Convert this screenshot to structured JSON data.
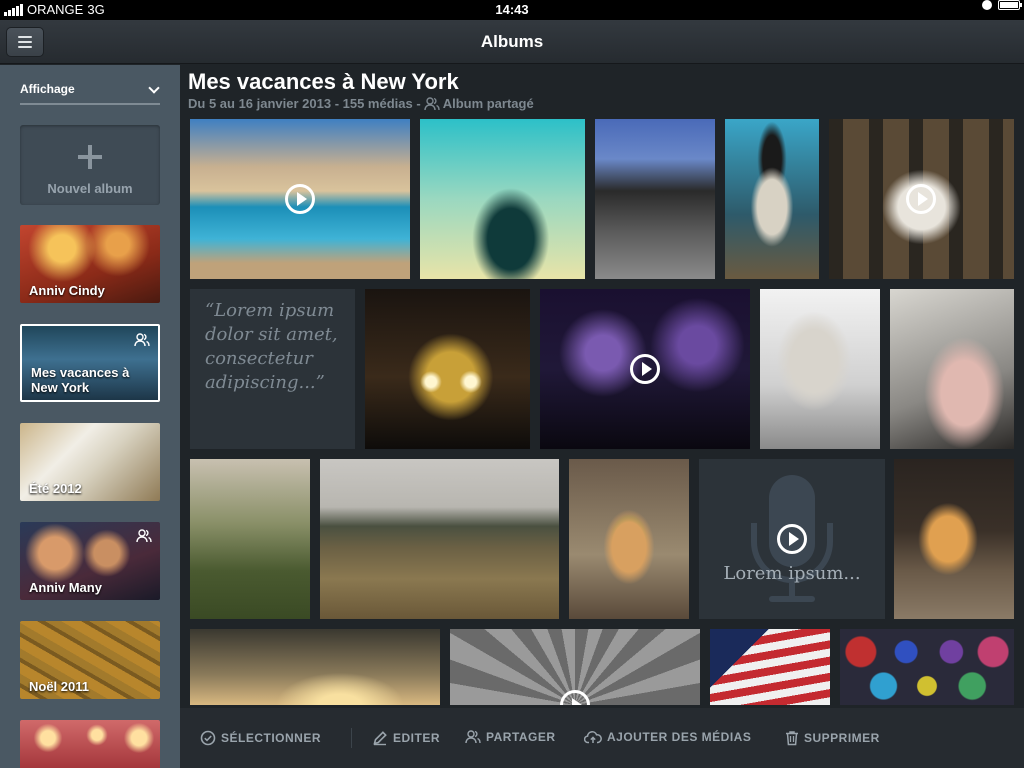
{
  "status_bar": {
    "carrier": "ORANGE",
    "network": "3G",
    "time": "14:43"
  },
  "header": {
    "title": "Albums"
  },
  "sidebar": {
    "display_label": "Affichage",
    "new_album_label": "Nouvel album",
    "albums": [
      {
        "label": "Anniv Cindy",
        "shared": false,
        "selected": false
      },
      {
        "label": "Mes vacances à New York",
        "shared": true,
        "selected": true
      },
      {
        "label": "Été 2012",
        "shared": false,
        "selected": false
      },
      {
        "label": "Anniv Many",
        "shared": true,
        "selected": false
      },
      {
        "label": "Noël 2011",
        "shared": false,
        "selected": false
      },
      {
        "label": "",
        "shared": false,
        "selected": false
      }
    ]
  },
  "album": {
    "title": "Mes vacances à New York",
    "subtitle": "Du 5 au 16 janvier 2013 - 155 médias -",
    "shared_label": "Album partagé",
    "quote": "“Lorem ipsum dolor sit amet, consectetur adipiscing...”",
    "audio_caption": "Lorem ipsum..."
  },
  "actions": {
    "select": "SÉLECTIONNER",
    "edit": "EDITER",
    "share": "PARTAGER",
    "add_media": "AJOUTER DES MÉDIAS",
    "delete": "SUPPRIMER"
  }
}
